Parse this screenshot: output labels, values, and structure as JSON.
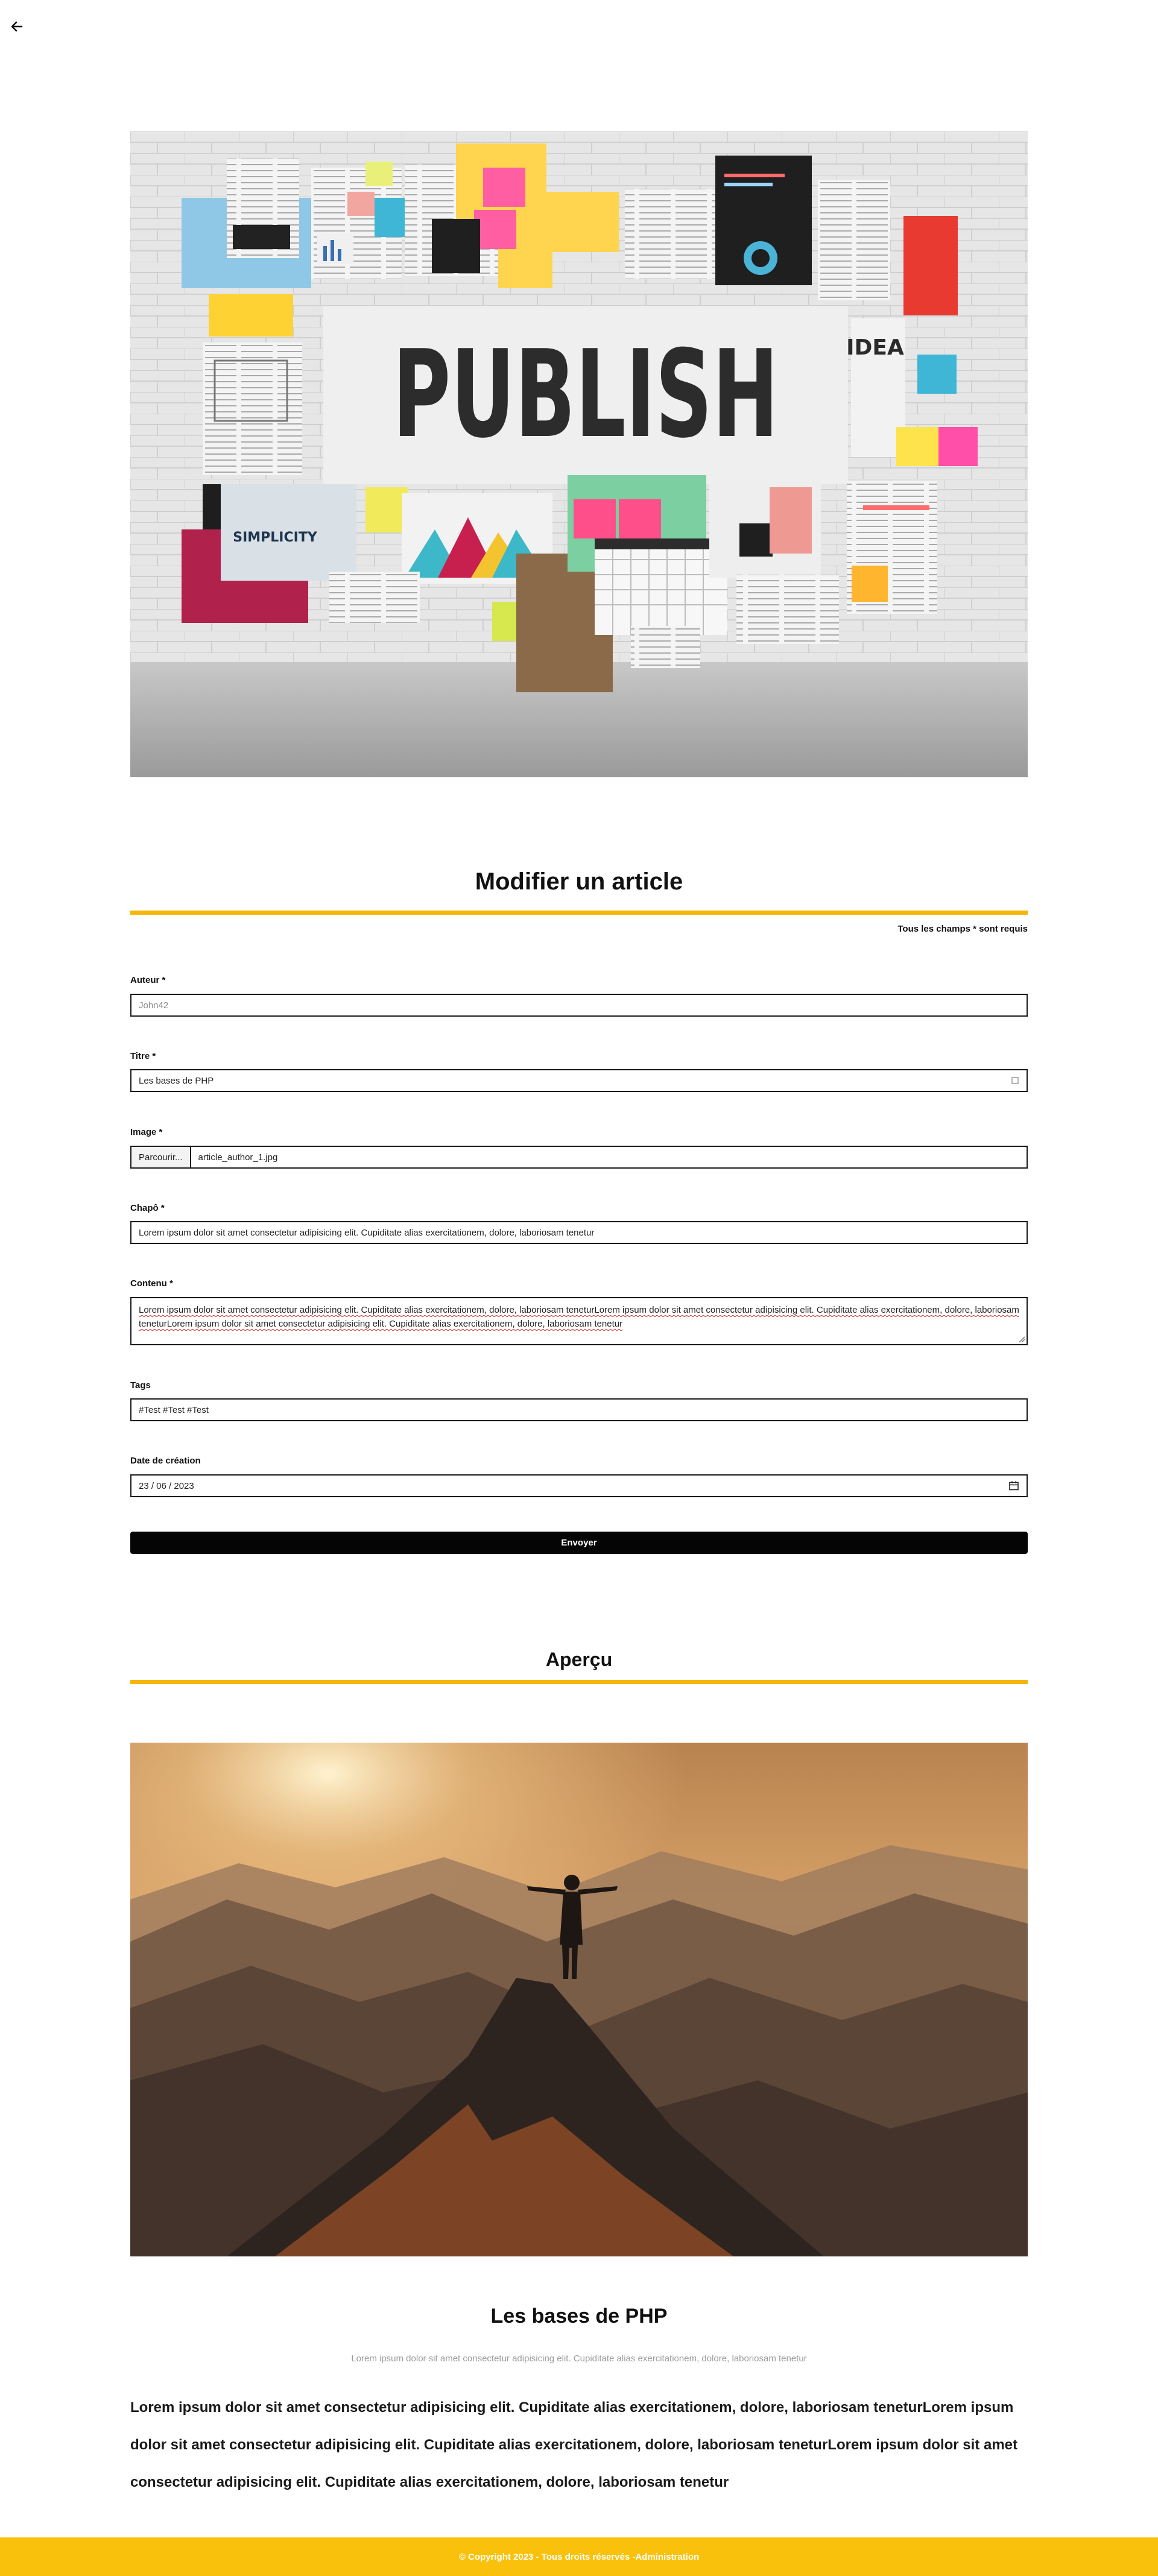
{
  "nav": {
    "back_icon": "arrow-left-icon"
  },
  "hero": {
    "headline": "PUBLISH",
    "badge_text": "SIMPLICITY",
    "idea_text": "IDEA"
  },
  "form": {
    "title": "Modifier un article",
    "required_note": "Tous les champs * sont requis",
    "fields": {
      "author": {
        "label": "Auteur *",
        "placeholder": "John42"
      },
      "title": {
        "label": "Titre *",
        "value": "Les bases de PHP"
      },
      "image": {
        "label": "Image *",
        "button": "Parcourir...",
        "filename": "article_author_1.jpg"
      },
      "chapo": {
        "label": "Chapô *",
        "value": "Lorem ipsum dolor sit amet consectetur adipisicing elit. Cupiditate alias exercitationem, dolore, laboriosam tenetur"
      },
      "content": {
        "label": "Contenu *",
        "value": "Lorem ipsum dolor sit amet consectetur adipisicing elit. Cupiditate alias exercitationem, dolore, laboriosam teneturLorem ipsum dolor sit amet consectetur adipisicing elit. Cupiditate alias exercitationem, dolore, laboriosam teneturLorem ipsum dolor sit amet consectetur adipisicing elit. Cupiditate alias exercitationem, dolore, laboriosam tenetur"
      },
      "tags": {
        "label": "Tags",
        "value": "#Test #Test #Test"
      },
      "date": {
        "label": "Date de création",
        "value": "23 / 06 / 2023",
        "icon": "calendar-icon"
      }
    },
    "submit_label": "Envoyer"
  },
  "preview": {
    "heading": "Aperçu",
    "title": "Les bases de PHP",
    "chapo": "Lorem ipsum dolor sit amet consectetur adipisicing elit. Cupiditate alias exercitationem, dolore, laboriosam tenetur",
    "content": "Lorem ipsum dolor sit amet consectetur adipisicing elit. Cupiditate alias exercitationem, dolore, laboriosam teneturLorem ipsum dolor sit amet consectetur adipisicing elit. Cupiditate alias exercitationem, dolore, laboriosam teneturLorem ipsum dolor sit amet consectetur adipisicing elit. Cupiditate alias exercitationem, dolore, laboriosam tenetur"
  },
  "footer": {
    "copyright": "© Copyright 2023 - Tous droits réservés - ",
    "admin_link": "Administration"
  },
  "colors": {
    "accent": "#f5b50a",
    "footer_bg": "#f9c10b",
    "button_bg": "#050505"
  }
}
